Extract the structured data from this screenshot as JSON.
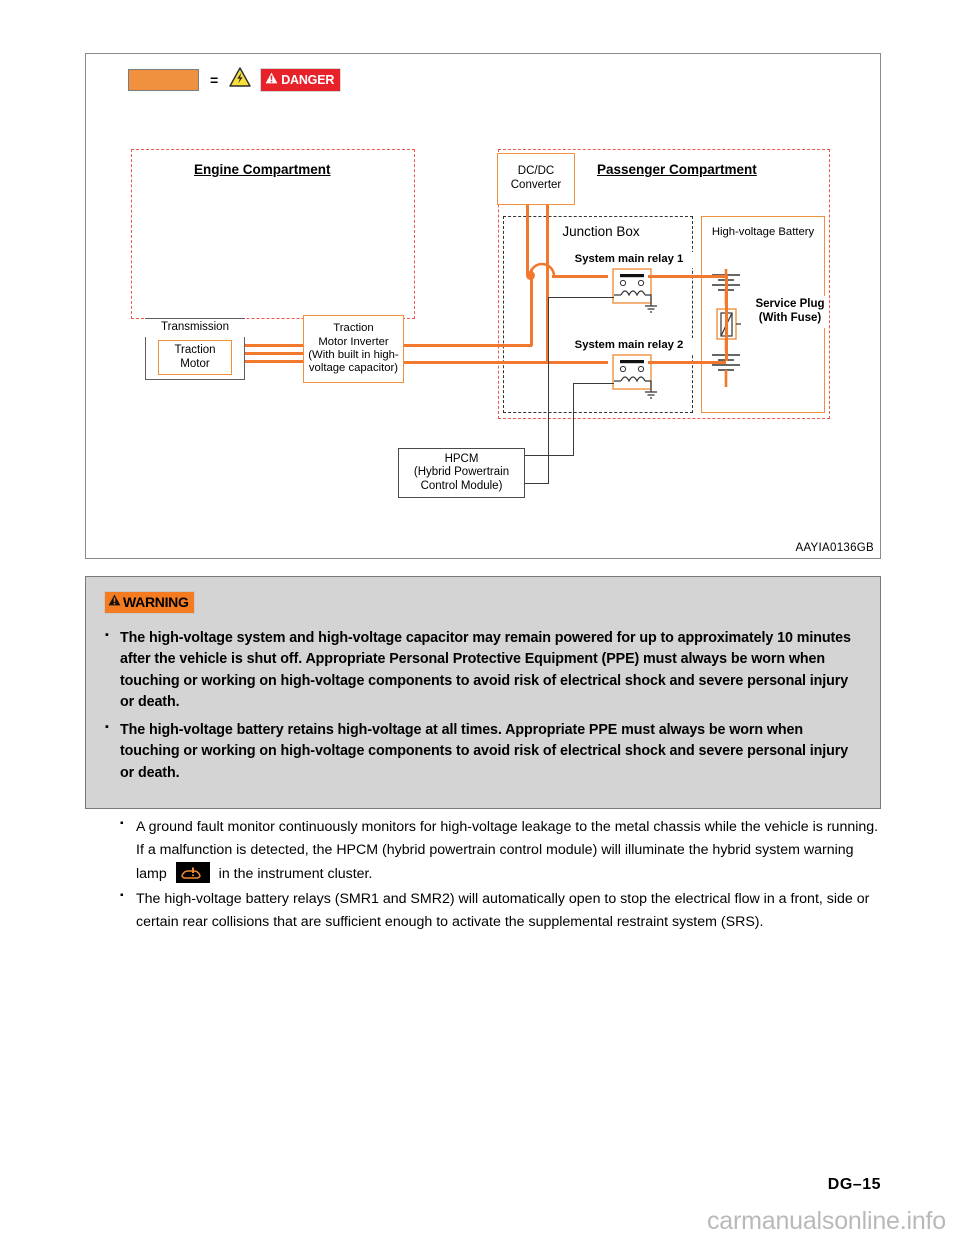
{
  "figure": {
    "id": "AAYIA0136GB",
    "legend": {
      "equals": "=",
      "danger_label": "DANGER",
      "hazard_icon": "electrical-hazard-icon",
      "swatch_color": "#F0913F"
    },
    "engine_compartment": {
      "title": "Engine Compartment",
      "transmission": "Transmission",
      "traction_motor": "Traction\nMotor",
      "inverter_line1": "Traction",
      "inverter_line2": "Motor Inverter",
      "inverter_line3": "(With built in high-",
      "inverter_line4": "voltage capacitor)"
    },
    "passenger_compartment": {
      "title": "Passenger Compartment",
      "dcdc_line1": "DC/DC",
      "dcdc_line2": "Converter",
      "junction_box": "Junction Box",
      "relay1": "System main relay 1",
      "relay2": "System main relay 2",
      "battery": "High-voltage Battery",
      "service_plug_line1": "Service Plug",
      "service_plug_line2": "(With Fuse)"
    },
    "hpcm": {
      "line1": "HPCM",
      "line2": "(Hybrid Powertrain",
      "line3": "Control Module)"
    }
  },
  "warning": {
    "tag": "WARNING",
    "items": [
      "The high-voltage system and high-voltage capacitor may remain powered for up to approximately 10 minutes after the vehicle is shut off. Appropriate Personal Protective Equipment (PPE) must always be worn when touching or working on high-voltage components to avoid risk of electrical shock and severe personal injury or death.",
      "The high-voltage battery retains high-voltage at all times. Appropriate PPE must always be worn when touching or working on high-voltage components to avoid risk of electrical shock and severe personal injury or death."
    ]
  },
  "body": {
    "item1_before": "A ground fault monitor continuously monitors for high-voltage leakage to the metal chassis while the vehicle is running. If a malfunction is detected, the HPCM (hybrid powertrain control module) will illuminate the hybrid system warning lamp",
    "item1_after": "in the instrument cluster.",
    "item2": "The high-voltage battery relays (SMR1 and SMR2) will automatically open to stop the electrical flow in a front, side or certain rear collisions that are sufficient enough to activate the supplemental restraint system (SRS)."
  },
  "footer": {
    "page_number": "DG–15",
    "watermark": "carmanualsonline.info"
  }
}
